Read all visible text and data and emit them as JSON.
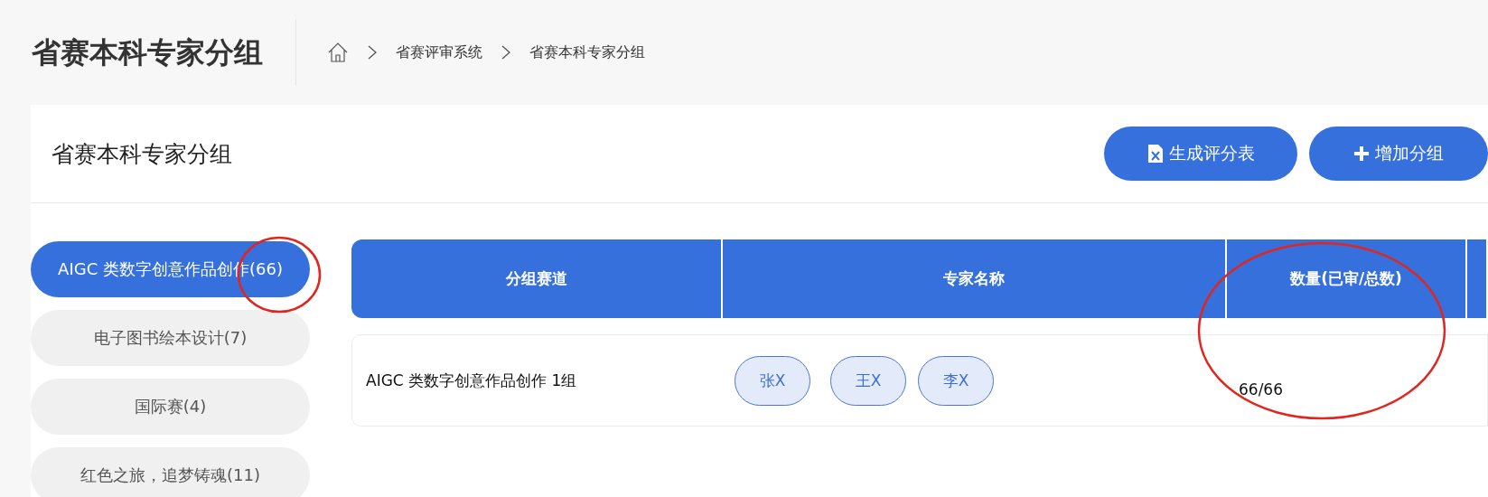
{
  "page_title": "省赛本科专家分组",
  "breadcrumb": [
    "省赛评审系统",
    "省赛本科专家分组"
  ],
  "card": {
    "title": "省赛本科专家分组",
    "buttons": [
      {
        "kind": "excel",
        "label": "生成评分表"
      },
      {
        "kind": "add",
        "label": "增加分组"
      }
    ]
  },
  "sidebar": {
    "items": [
      {
        "label": "AIGC 类数字创意作品创作(66)",
        "selected": true
      },
      {
        "label": "电子图书绘本设计(7)",
        "selected": false
      },
      {
        "label": "国际赛(4)",
        "selected": false
      },
      {
        "label": "红色之旅，追梦铸魂(11)",
        "selected": false
      }
    ]
  },
  "table": {
    "columns": [
      "分组赛道",
      "专家名称",
      "数量(已审/总数)",
      ""
    ],
    "rows": [
      {
        "track": "AIGC 类数字创意作品创作 1组",
        "experts": [
          "张X",
          "王X",
          "李X"
        ],
        "count": "66/66"
      }
    ]
  }
}
